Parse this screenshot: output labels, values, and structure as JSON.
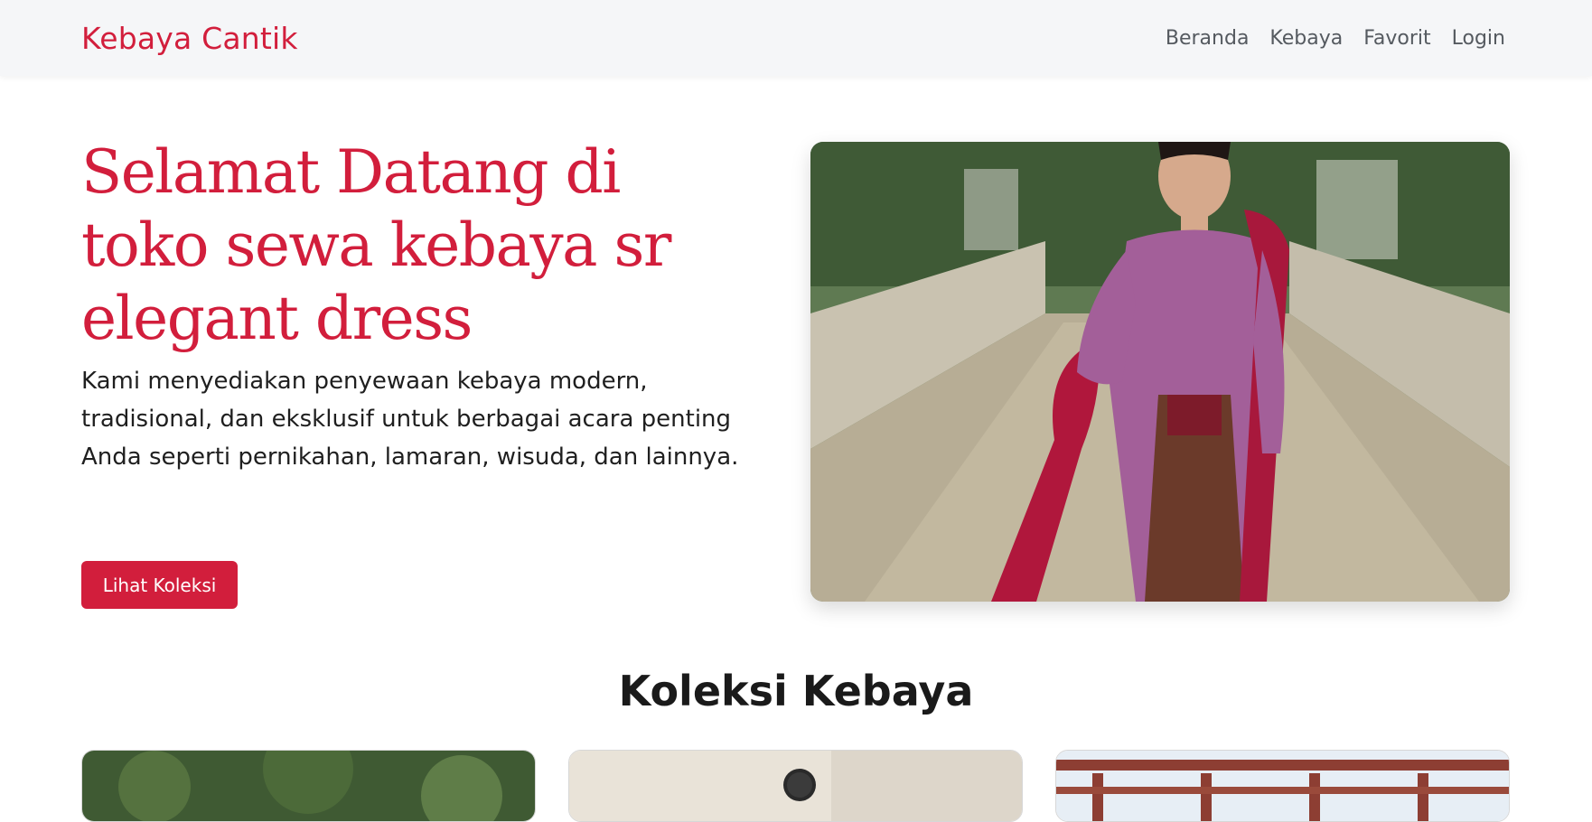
{
  "navbar": {
    "brand": "Kebaya Cantik",
    "links": [
      "Beranda",
      "Kebaya",
      "Favorit",
      "Login"
    ]
  },
  "hero": {
    "title": "Selamat Datang di toko sewa kebaya sr elegant dress",
    "description": "Kami menyediakan penyewaan kebaya modern, tradisional, dan eksklusif untuk berbagai acara penting Anda seperti pernikahan, lamaran, wisuda, dan lainnya.",
    "cta_label": "Lihat Koleksi"
  },
  "collection": {
    "title": "Koleksi Kebaya"
  },
  "colors": {
    "accent": "#d21e3c",
    "navbar_bg": "#f5f6f8"
  }
}
